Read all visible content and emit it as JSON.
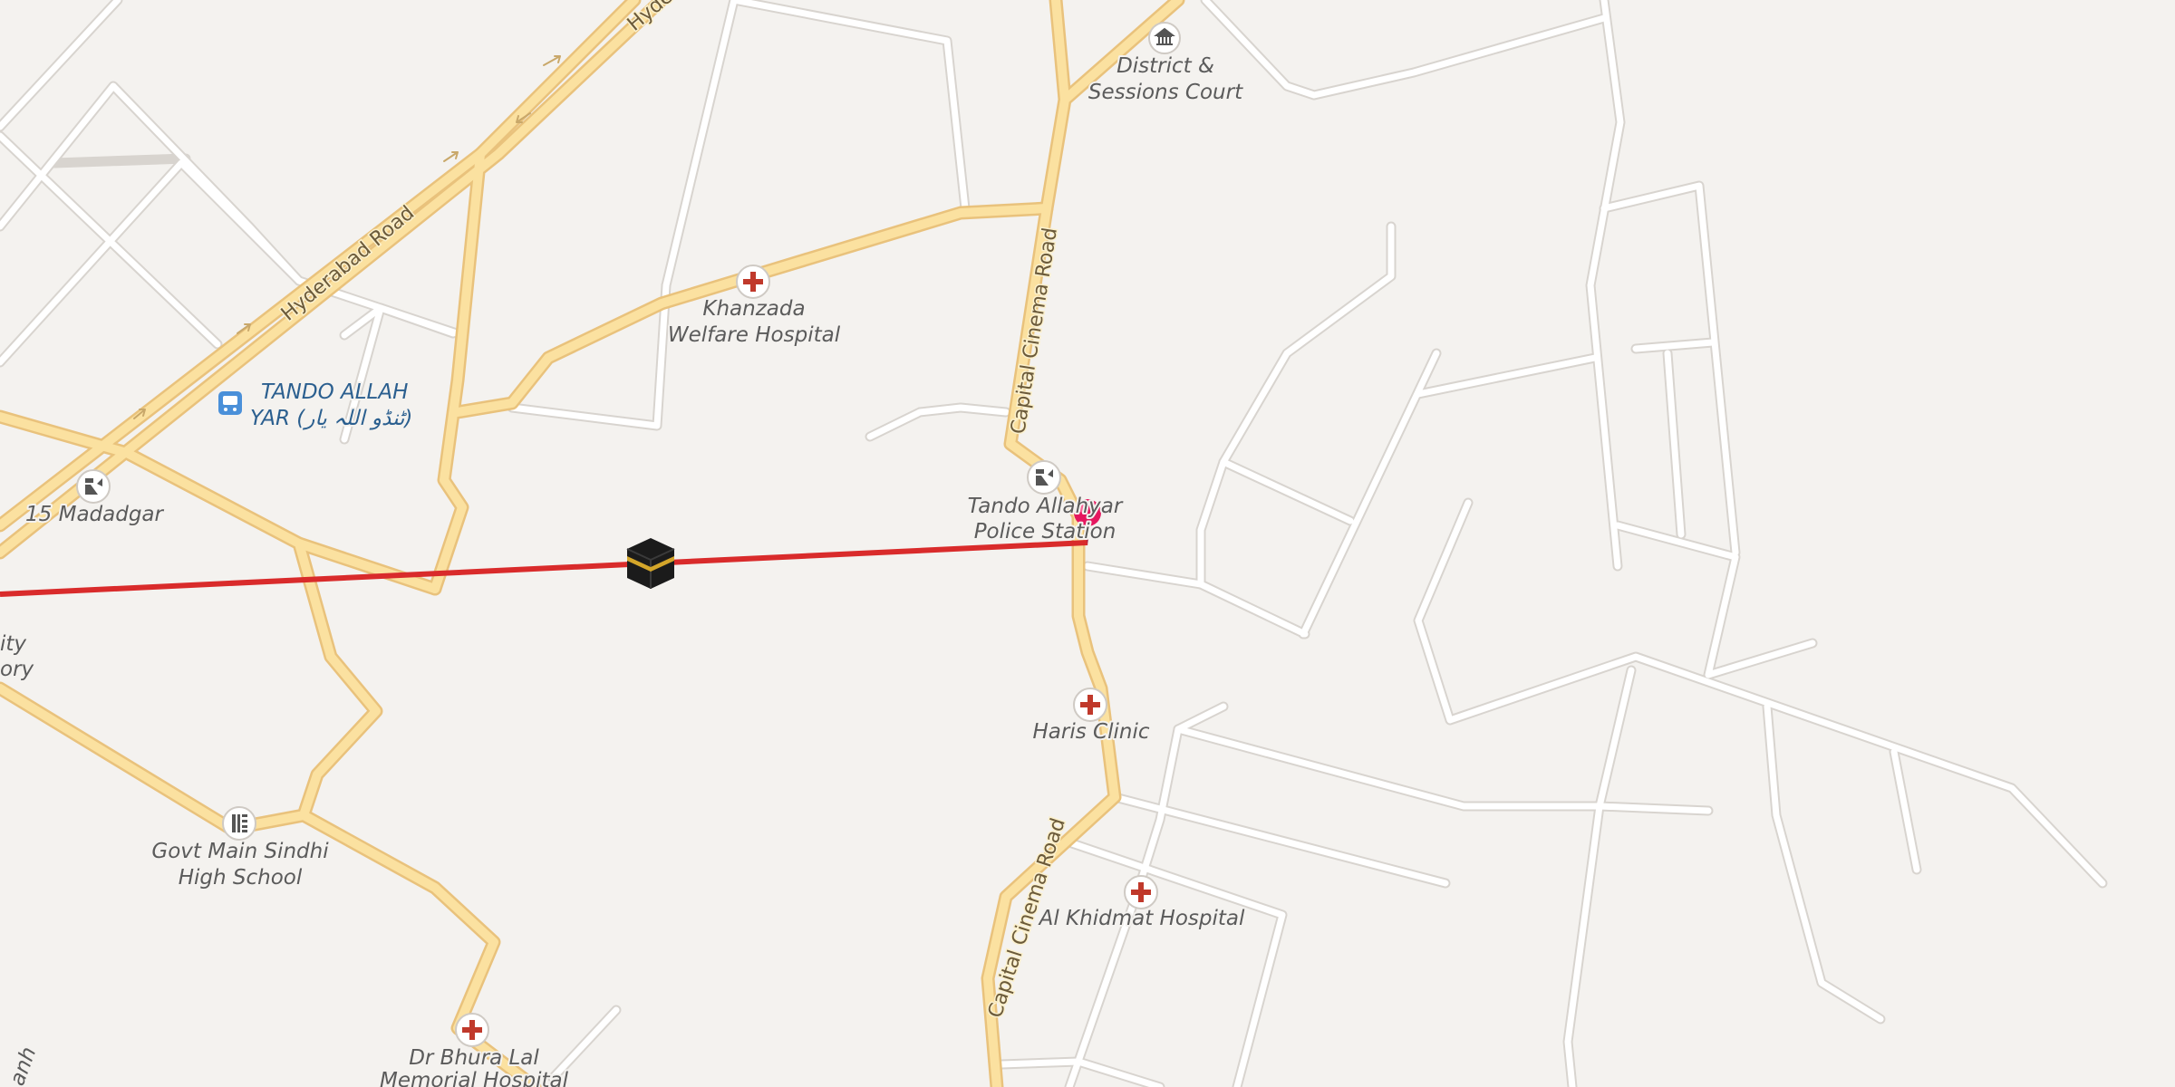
{
  "map": {
    "roads": {
      "hyderabad_road": "Hyderabad Road",
      "hyderabad_road_cut": "Hyde",
      "capital_cinema_road": "Capital Cinema Road"
    },
    "places": {
      "district_court": [
        "District &",
        "Sessions Court"
      ],
      "khanzada": [
        "Khanzada",
        "Welfare Hospital"
      ],
      "tando_allah_yar": [
        "TANDO ALLAH",
        "YAR (ٹنڈو اللہ یار)"
      ],
      "madadgar": "15 Madadgar",
      "police_station": [
        "Tando Allahyar",
        "Police Station"
      ],
      "haris_clinic": "Haris Clinic",
      "govt_school": [
        "Govt Main Sindhi",
        "High School"
      ],
      "al_khidmat": "Al Khidmat Hospital",
      "dr_bhura": [
        "Dr Bhura Lal",
        "Memorial Hospital"
      ],
      "edge_partial": [
        "ity",
        "ory"
      ],
      "edge_road_partial": "anh"
    },
    "icons": {
      "qibla": "kaaba-icon",
      "pin": "map-pin-icon",
      "hospital": "hospital-cross-icon",
      "police": "police-icon",
      "court": "courthouse-icon",
      "school": "school-icon",
      "bus": "bus-stop-icon"
    },
    "colors": {
      "background": "#f4f2ef",
      "major_road_fill": "#fbe1a0",
      "major_road_casing": "#e9c27c",
      "minor_road": "#ffffff",
      "minor_road_casing": "#d8d4cf",
      "qibla_line": "#d92b2b",
      "pin": "#e5175f",
      "hospital_cross": "#c0392b",
      "bus_blue": "#4a90d9"
    }
  }
}
